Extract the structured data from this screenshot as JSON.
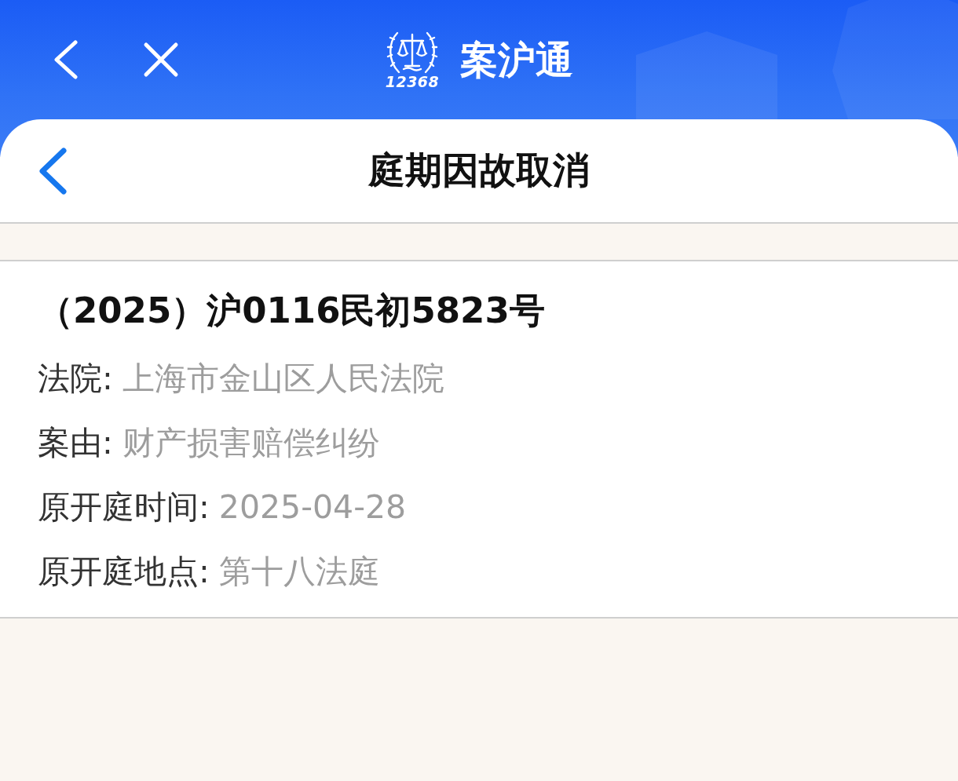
{
  "header": {
    "logo_text": "12368",
    "title": "案沪通"
  },
  "page": {
    "title": "庭期因故取消"
  },
  "case": {
    "number": "（2025）沪0116民初5823号",
    "fields": [
      {
        "label": "法院:",
        "value": "上海市金山区人民法院"
      },
      {
        "label": "案由:",
        "value": "财产损害赔偿纠纷"
      },
      {
        "label": "原开庭时间:",
        "value": "2025-04-28"
      },
      {
        "label": "原开庭地点:",
        "value": "第十八法庭"
      }
    ]
  }
}
